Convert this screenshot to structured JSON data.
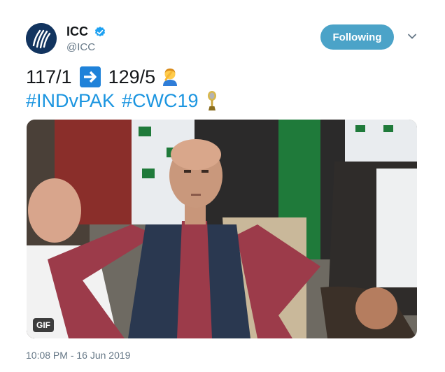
{
  "author": {
    "display_name": "ICC",
    "handle": "@ICC",
    "verified": true,
    "avatar": "icc-logo"
  },
  "follow_button": {
    "label": "Following",
    "color": "#4ba3c8"
  },
  "menu": {
    "icon": "chevron-down-icon"
  },
  "tweet": {
    "score_before": "117/1",
    "arrow": "arrow-right-emoji",
    "score_after": "129/5",
    "emoji_end": "facepalm-emoji",
    "hashtag_1": "#INDvPAK",
    "hashtag_2": "#CWC19",
    "trophy": "trophy-icon",
    "hashtag_color": "#1b95e0"
  },
  "media": {
    "type": "gif",
    "badge": "GIF",
    "subject": "spectator-hands-on-hips"
  },
  "timestamp": "10:08 PM - 16 Jun 2019"
}
